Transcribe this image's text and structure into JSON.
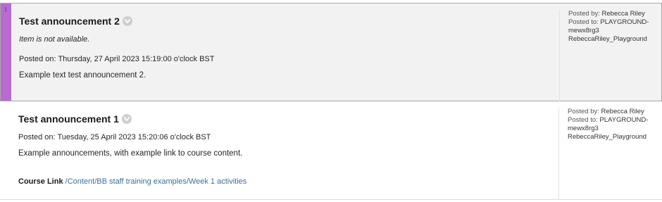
{
  "announcements": [
    {
      "title": "Test announcement 2",
      "availability": "Item is not available.",
      "posted_on": "Posted on: Thursday, 27 April 2023 15:19:00 o'clock BST",
      "body": "Example text test announcement 2.",
      "meta": {
        "posted_by_label": "Posted by:",
        "posted_by": "Rebecca Riley",
        "posted_to_label": "Posted to:",
        "posted_to_line1": "PLAYGROUND-",
        "posted_to_line2": "mewx8rg3",
        "posted_to_line3": "RebeccaRiley_Playground"
      }
    },
    {
      "title": "Test announcement 1",
      "posted_on": "Posted on: Tuesday, 25 April 2023 15:20:06 o'clock BST",
      "body": "Example announcements, with example link to course content.",
      "course_link_label": "Course Link",
      "course_link_text": "/Content/BB staff training examples/Week 1 activities",
      "meta": {
        "posted_by_label": "Posted by:",
        "posted_by": "Rebecca Riley",
        "posted_to_label": "Posted to:",
        "posted_to_line1": "PLAYGROUND-",
        "posted_to_line2": "mewx8rg3",
        "posted_to_line3": "RebeccaRiley_Playground"
      }
    }
  ],
  "colors": {
    "drag_bar": "#b96bd1",
    "selected_bg": "#f2f2f2",
    "link": "#3f6f9a"
  },
  "icons": {
    "drag_handle": "drag-handle-icon",
    "menu": "chevron-down-icon"
  }
}
